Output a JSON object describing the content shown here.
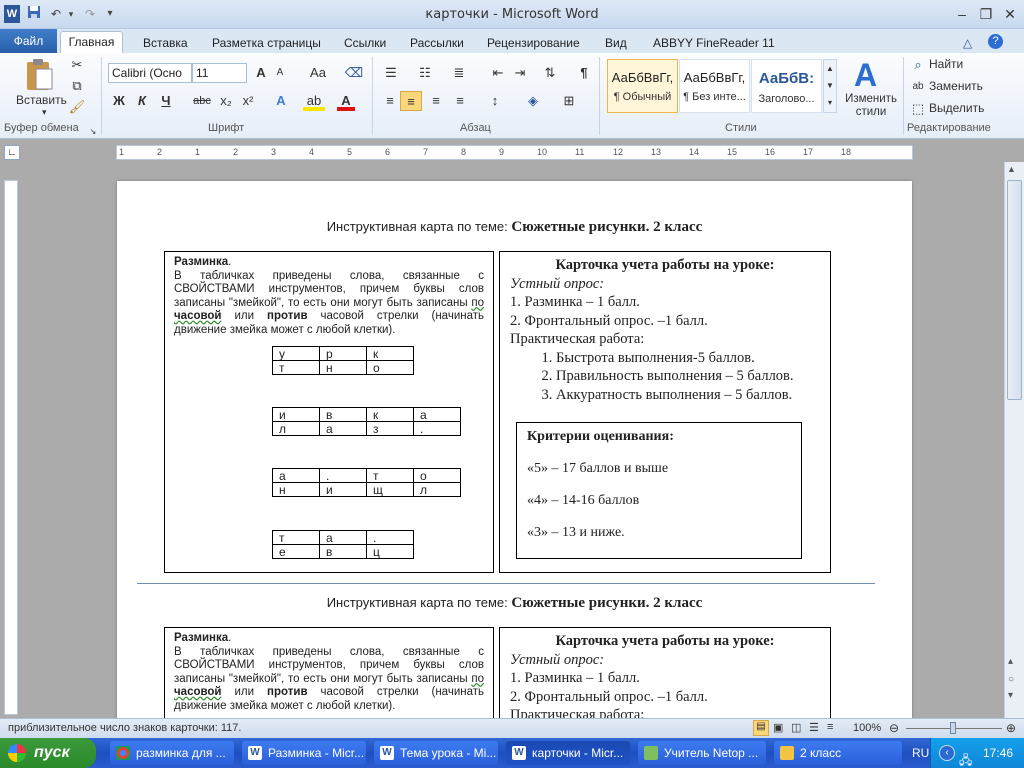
{
  "window": {
    "title": "карточки  -  Microsoft Word"
  },
  "quick_access": {
    "undo": "↶",
    "redo": "↷",
    "menu": "▾"
  },
  "tabs": [
    {
      "label": "Файл"
    },
    {
      "label": "Главная"
    },
    {
      "label": "Вставка"
    },
    {
      "label": "Разметка страницы"
    },
    {
      "label": "Ссылки"
    },
    {
      "label": "Рассылки"
    },
    {
      "label": "Рецензирование"
    },
    {
      "label": "Вид"
    },
    {
      "label": "ABBYY FineReader 11"
    }
  ],
  "ribbon": {
    "clipboard": {
      "paste": "Вставить",
      "label": "Буфер обмена"
    },
    "font": {
      "name": "Calibri (Осно",
      "size": "11",
      "label": "Шрифт",
      "bold": "Ж",
      "italic": "К",
      "underline": "Ч",
      "strike": "abc",
      "sub": "x₂",
      "sup": "x²",
      "grow": "A",
      "shrink": "A",
      "case": "Aa"
    },
    "paragraph": {
      "label": "Абзац",
      "pilcrow": "¶"
    },
    "styles": {
      "label": "Стили",
      "items": [
        {
          "preview": "АаБбВвГг,",
          "name": "¶ Обычный"
        },
        {
          "preview": "АаБбВвГг,",
          "name": "¶ Без инте..."
        },
        {
          "preview": "АаБбВ:",
          "name": "Заголово..."
        }
      ],
      "change": "Изменить стили"
    },
    "editing": {
      "label": "Редактирование",
      "find": "Найти",
      "replace": "Заменить",
      "select": "Выделить"
    }
  },
  "ruler": {
    "marks": [
      "1",
      "2",
      "1",
      "2",
      "3",
      "4",
      "5",
      "6",
      "7",
      "8",
      "9",
      "10",
      "11",
      "12",
      "13",
      "14",
      "15",
      "16",
      "17",
      "18"
    ]
  },
  "document": {
    "cards": [
      {
        "heading_prefix": "Инструктивная карта по теме: ",
        "heading_bold": "Сюжетные рисунки.   2 класс",
        "left": {
          "warmup_title": "Разминка",
          "text1": "В табличках приведены слова, связанные с СВОЙСТВАМИ инструментов, причем буквы слов записаны \"змейкой\", то есть они могут быть записаны ",
          "text_by": "по",
          "text_clock": "часовой",
          "text_or": " или ",
          "text_against": "против",
          "text2": " часовой стрелки (начинать движение змейка может с любой клетки).",
          "tables": [
            [
              [
                "у",
                "р",
                "к"
              ],
              [
                "т",
                "н",
                "о"
              ]
            ],
            [
              [
                "и",
                "в",
                "к",
                "а"
              ],
              [
                "л",
                "а",
                "з",
                "."
              ]
            ],
            [
              [
                "а",
                ".",
                "т",
                "о"
              ],
              [
                "н",
                "и",
                "щ",
                "л"
              ]
            ],
            [
              [
                "т",
                "а",
                "."
              ],
              [
                "е",
                "в",
                "ц"
              ]
            ]
          ]
        },
        "right": {
          "title": "Карточка учета работы на уроке:",
          "oral": "Устный  опрос:",
          "item1": "1. Разминка – 1 балл.",
          "item2": "2. Фронтальный опрос. –1 балл.",
          "practical": "Практическая работа:",
          "list": [
            "Быстрота выполнения-5 баллов.",
            "Правильность выполнения – 5 баллов.",
            "Аккуратность выполнения – 5 баллов."
          ],
          "criteria_title": "Критерии оценивания:",
          "criteria": [
            "«5» – 17 баллов и выше",
            "«4» – 14-16 баллов",
            "«3» – 13 и ниже."
          ]
        }
      }
    ]
  },
  "status": {
    "text": "приблизительное число знаков карточки: 117.",
    "zoom": "100%"
  },
  "taskbar": {
    "start": "пуск",
    "tasks": [
      {
        "label": "разминка для ..."
      },
      {
        "label": "Разминка - Micr..."
      },
      {
        "label": "Тема урока - Mi..."
      },
      {
        "label": "карточки - Micr..."
      },
      {
        "label": "Учитель Netop ..."
      },
      {
        "label": "2 класс"
      }
    ],
    "lang": "RU",
    "time": "17:46"
  },
  "colors": {
    "accent": "#2b579a",
    "taskbar": "#245edb",
    "start": "#3c9a3c"
  }
}
